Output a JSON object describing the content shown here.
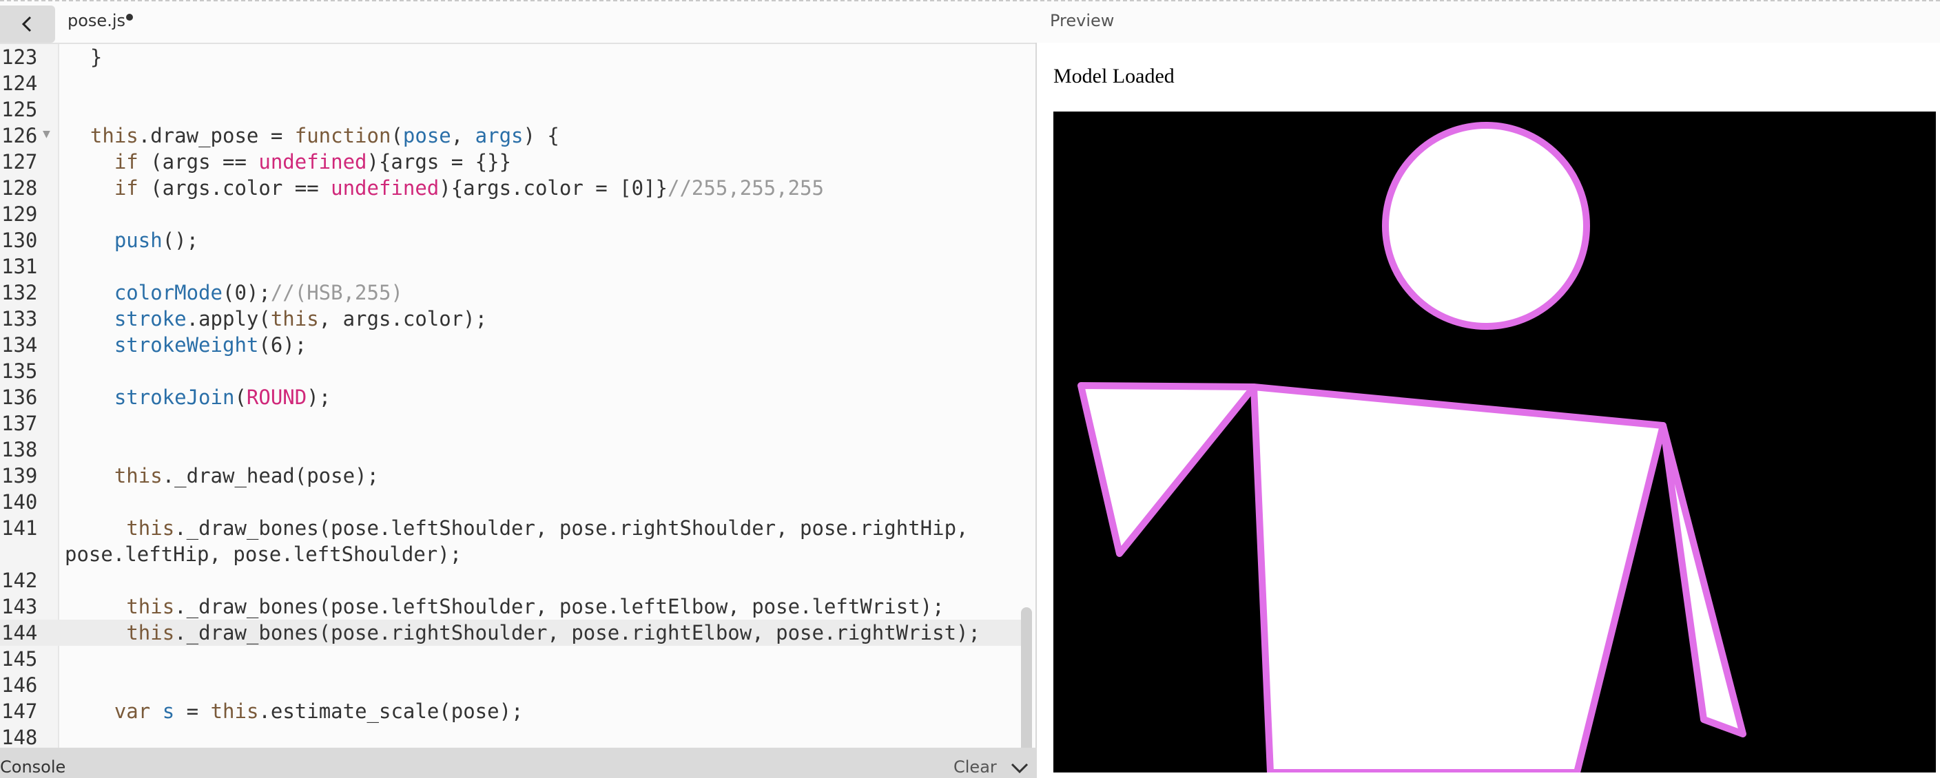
{
  "header": {
    "file_tab": "pose.js",
    "preview_label": "Preview"
  },
  "editor": {
    "lines": [
      {
        "n": "123",
        "code": "  }"
      },
      {
        "n": "124",
        "code": ""
      },
      {
        "n": "125",
        "code": ""
      },
      {
        "n": "126",
        "code": "  this.draw_pose = function(pose, args) {"
      },
      {
        "n": "127",
        "code": "    if (args == undefined){args = {}}"
      },
      {
        "n": "128",
        "code": "    if (args.color == undefined){args.color = [0]}//255,255,255"
      },
      {
        "n": "129",
        "code": ""
      },
      {
        "n": "130",
        "code": "    push();"
      },
      {
        "n": "131",
        "code": ""
      },
      {
        "n": "132",
        "code": "    colorMode(0);//(HSB,255)"
      },
      {
        "n": "133",
        "code": "    stroke.apply(this, args.color);"
      },
      {
        "n": "134",
        "code": "    strokeWeight(6);"
      },
      {
        "n": "135",
        "code": ""
      },
      {
        "n": "136",
        "code": "    strokeJoin(ROUND);"
      },
      {
        "n": "137",
        "code": ""
      },
      {
        "n": "138",
        "code": ""
      },
      {
        "n": "139",
        "code": "    this._draw_head(pose);"
      },
      {
        "n": "140",
        "code": ""
      },
      {
        "n": "141",
        "code": "     this._draw_bones(pose.leftShoulder, pose.rightShoulder, pose.rightHip,"
      },
      {
        "n": "",
        "code": "pose.leftHip, pose.leftShoulder);"
      },
      {
        "n": "142",
        "code": ""
      },
      {
        "n": "143",
        "code": "     this._draw_bones(pose.leftShoulder, pose.leftElbow, pose.leftWrist);"
      },
      {
        "n": "144",
        "code": "     this._draw_bones(pose.rightShoulder, pose.rightElbow, pose.rightWrist);"
      },
      {
        "n": "145",
        "code": ""
      },
      {
        "n": "146",
        "code": ""
      },
      {
        "n": "147",
        "code": "    var s = this.estimate_scale(pose);"
      },
      {
        "n": "148",
        "code": ""
      }
    ]
  },
  "console": {
    "label": "Console",
    "clear_label": "Clear"
  },
  "preview": {
    "status_text": "Model Loaded"
  },
  "colors": {
    "stroke": "#e070e8",
    "canvas_bg": "#000000",
    "fill": "#ffffff"
  }
}
